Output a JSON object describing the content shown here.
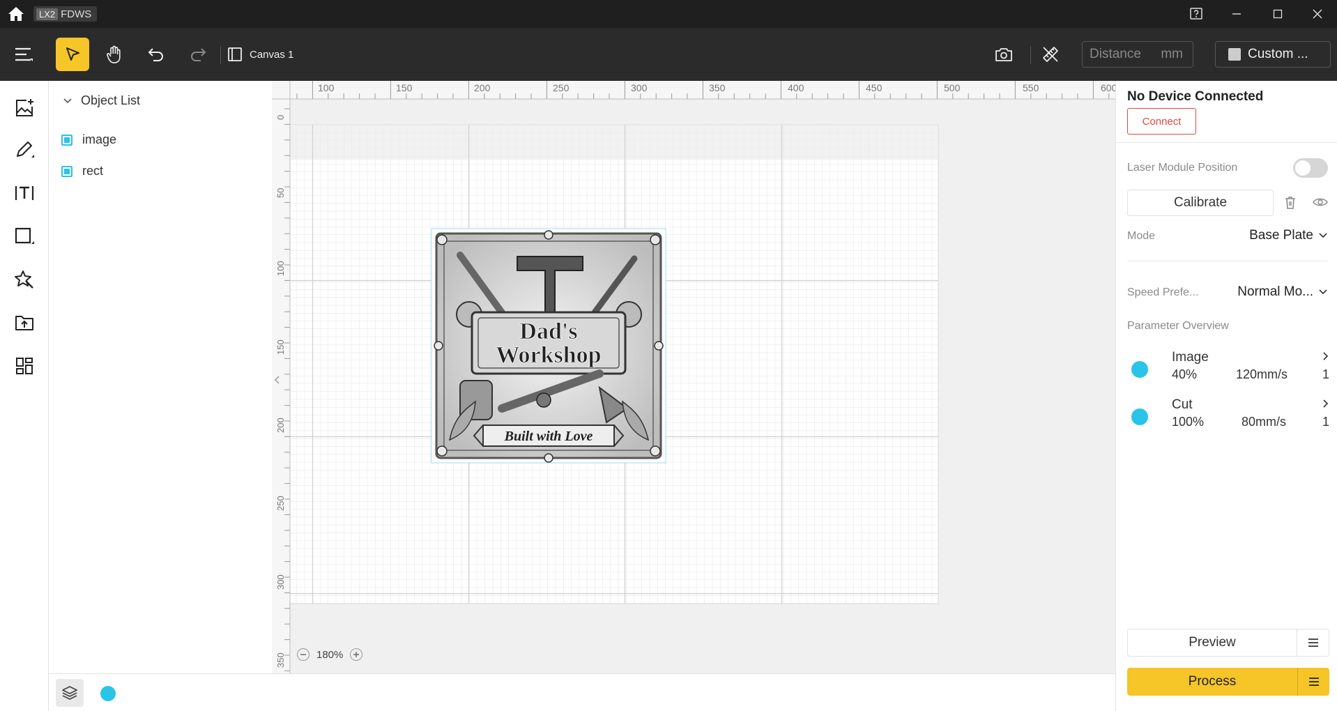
{
  "titlebar": {
    "app_tag": "LX2",
    "app_name": "FDWS"
  },
  "toolbar": {
    "canvas_label": "Canvas 1",
    "distance_placeholder": "Distance",
    "distance_unit": "mm",
    "material_label": "Custom ..."
  },
  "objects": {
    "header": "Object List",
    "items": [
      {
        "label": "image"
      },
      {
        "label": "rect"
      }
    ]
  },
  "ruler": {
    "h_labels": [
      "100",
      "150",
      "200",
      "250",
      "300",
      "350",
      "400",
      "450",
      "500",
      "550",
      "600"
    ],
    "v_labels": [
      "0",
      "50",
      "100",
      "150",
      "200",
      "250",
      "300",
      "350"
    ]
  },
  "artwork": {
    "title_line1": "Dad's",
    "title_line2": "Workshop",
    "ribbon": "Built with Love"
  },
  "zoom": {
    "value": "180%"
  },
  "device": {
    "status": "No Device Connected",
    "connect_label": "Connect"
  },
  "settings": {
    "laser_position_label": "Laser Module Position",
    "laser_position_on": false,
    "calibrate_label": "Calibrate",
    "mode_label": "Mode",
    "mode_value": "Base Plate",
    "speed_label": "Speed Prefe...",
    "speed_value": "Normal Mo...",
    "overview_label": "Parameter Overview"
  },
  "parameters": [
    {
      "name": "Image",
      "power": "40%",
      "speed": "120mm/s",
      "passes": "1",
      "color": "#29c4e8"
    },
    {
      "name": "Cut",
      "power": "100%",
      "speed": "80mm/s",
      "passes": "1",
      "color": "#29c4e8"
    }
  ],
  "actions": {
    "preview_label": "Preview",
    "process_label": "Process"
  },
  "colors": {
    "accent": "#f6c527",
    "layer": "#29c4e8",
    "danger": "#e0483e"
  }
}
